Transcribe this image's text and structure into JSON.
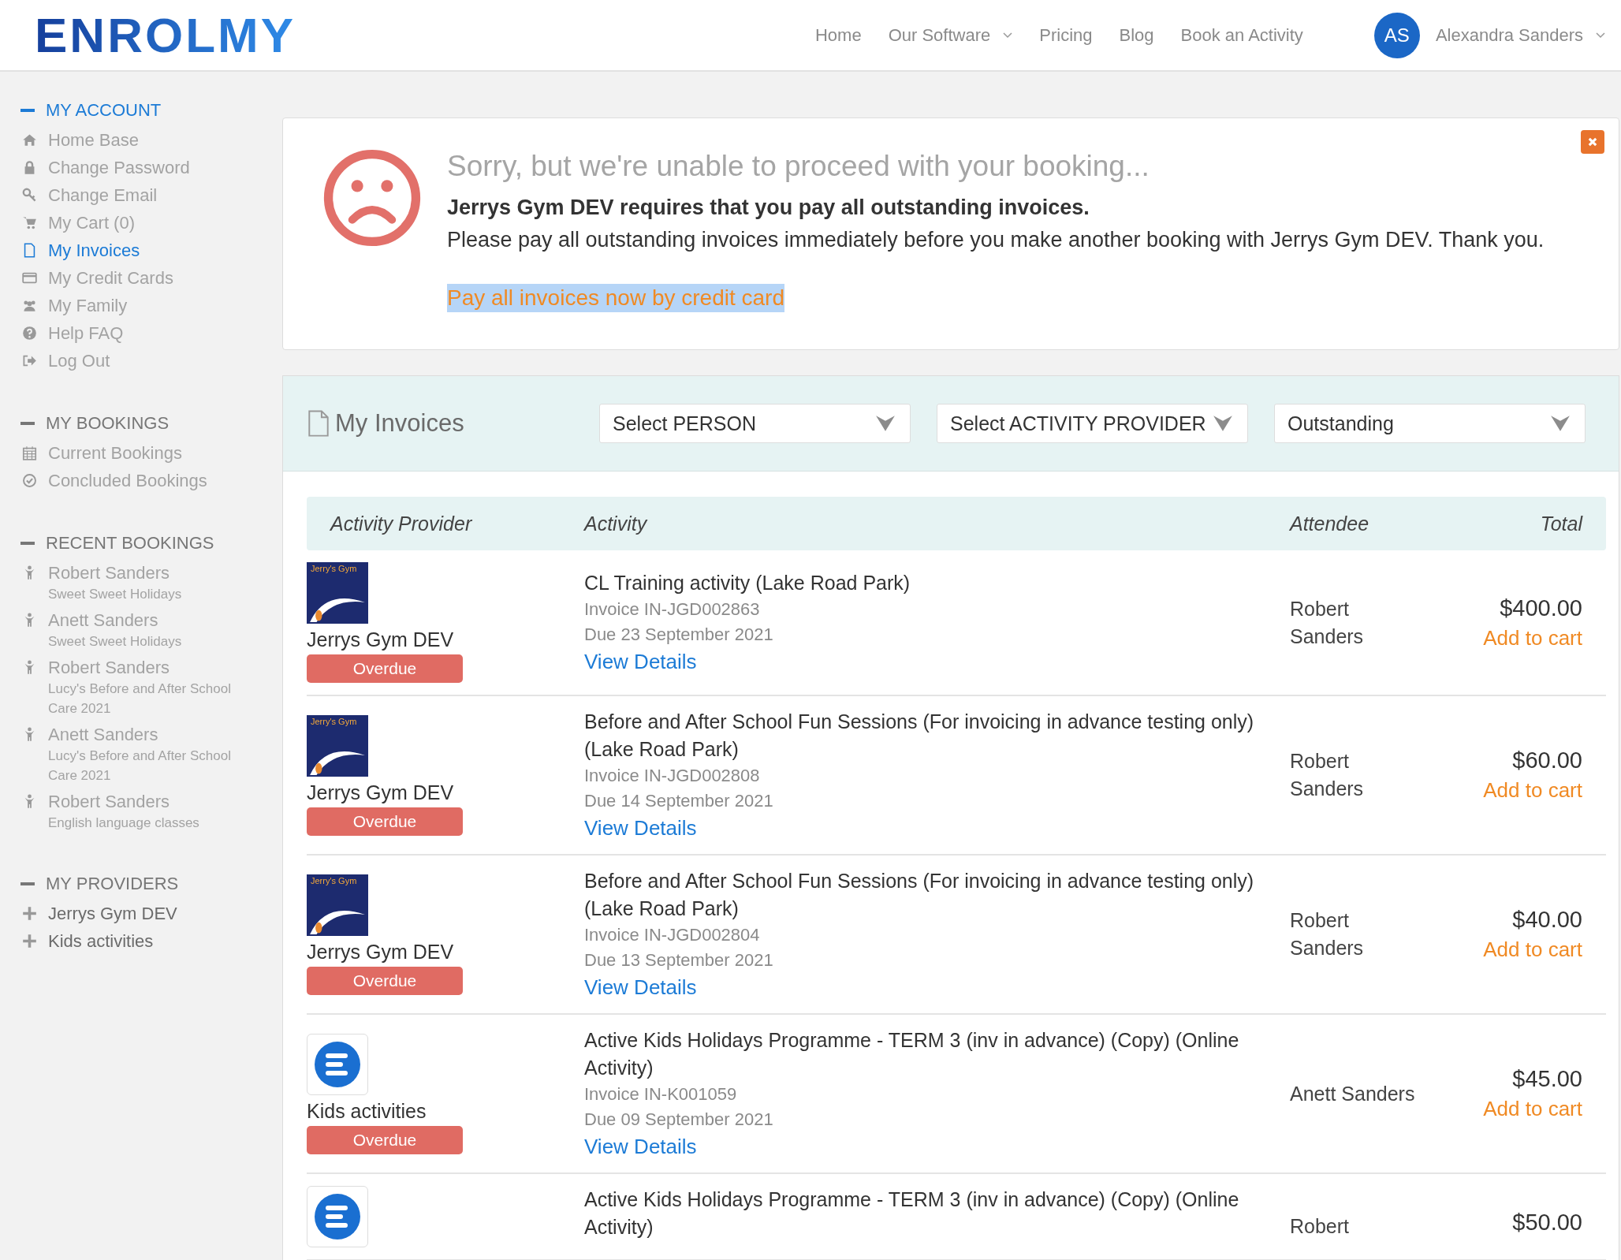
{
  "header": {
    "logo": "ENROLMY",
    "nav": [
      {
        "label": "Home",
        "dropdown": false
      },
      {
        "label": "Our Software",
        "dropdown": true
      },
      {
        "label": "Pricing",
        "dropdown": false
      },
      {
        "label": "Blog",
        "dropdown": false
      },
      {
        "label": "Book an Activity",
        "dropdown": false
      }
    ],
    "user": {
      "initials": "AS",
      "name": "Alexandra Sanders",
      "dropdown": true
    }
  },
  "sidebar": [
    {
      "title": "MY ACCOUNT",
      "active": true,
      "items": [
        {
          "label": "Home Base",
          "kind": "home",
          "selected": false
        },
        {
          "label": "Change Password",
          "kind": "lock",
          "selected": false
        },
        {
          "label": "Change Email",
          "kind": "key",
          "selected": false
        },
        {
          "label": "My Cart (0)",
          "kind": "cart",
          "selected": false
        },
        {
          "label": "My Invoices",
          "kind": "file",
          "selected": true
        },
        {
          "label": "My Credit Cards",
          "kind": "card",
          "selected": false
        },
        {
          "label": "My Family",
          "kind": "users",
          "selected": false
        },
        {
          "label": "Help FAQ",
          "kind": "help",
          "selected": false
        },
        {
          "label": "Log Out",
          "kind": "logout",
          "selected": false
        }
      ]
    },
    {
      "title": "MY BOOKINGS",
      "active": false,
      "items": [
        {
          "label": "Current Bookings",
          "kind": "calendar",
          "selected": false
        },
        {
          "label": "Concluded Bookings",
          "kind": "check",
          "selected": false
        }
      ]
    },
    {
      "title": "RECENT BOOKINGS",
      "active": false,
      "items": [
        {
          "label": "Robert Sanders",
          "sub": "Sweet Sweet Holidays",
          "kind": "person",
          "selected": false
        },
        {
          "label": "Anett Sanders",
          "sub": "Sweet Sweet Holidays",
          "kind": "person",
          "selected": false
        },
        {
          "label": "Robert Sanders",
          "sub": "Lucy's Before and After School Care 2021",
          "kind": "person",
          "selected": false
        },
        {
          "label": "Anett Sanders",
          "sub": "Lucy's Before and After School Care 2021",
          "kind": "person",
          "selected": false
        },
        {
          "label": "Robert Sanders",
          "sub": "English language classes",
          "kind": "person",
          "selected": false
        }
      ]
    },
    {
      "title": "MY PROVIDERS",
      "active": false,
      "items": [
        {
          "label": "Jerrys Gym DEV",
          "kind": "plus",
          "selected": false
        },
        {
          "label": "Kids activities",
          "kind": "plus",
          "selected": false
        }
      ]
    }
  ],
  "alert": {
    "title": "Sorry, but we're unable to proceed with your booking...",
    "bold": "Jerrys Gym DEV requires that you pay all outstanding invoices.",
    "message": "Please pay all outstanding invoices immediately before you make another booking with Jerrys Gym DEV. Thank you.",
    "link": "Pay all invoices now by credit card",
    "link_highlighted": true
  },
  "invoices": {
    "title": "My Invoices",
    "filters": [
      {
        "label": "Select PERSON"
      },
      {
        "label": "Select ACTIVITY PROVIDER"
      },
      {
        "label": "Outstanding"
      }
    ],
    "columns": [
      "Activity Provider",
      "Activity",
      "Attendee",
      "Total"
    ],
    "rows": [
      {
        "kind": "gym",
        "logo_text": "Jerry's Gym",
        "provider": "Jerrys Gym DEV",
        "status": "Overdue",
        "activity": "CL Training activity (Lake Road Park)",
        "invoice": "Invoice IN-JGD002863",
        "due": "Due 23 September 2021",
        "link": "View Details",
        "attendee": "Robert Sanders",
        "total": "$400.00",
        "action": "Add to cart"
      },
      {
        "kind": "gym",
        "logo_text": "Jerry's Gym",
        "provider": "Jerrys Gym DEV",
        "status": "Overdue",
        "activity": "Before and After School Fun Sessions (For invoicing in advance testing only) (Lake Road Park)",
        "invoice": "Invoice IN-JGD002808",
        "due": "Due 14 September 2021",
        "link": "View Details",
        "attendee": "Robert Sanders",
        "total": "$60.00",
        "action": "Add to cart"
      },
      {
        "kind": "gym",
        "logo_text": "Jerry's Gym",
        "provider": "Jerrys Gym DEV",
        "status": "Overdue",
        "activity": "Before and After School Fun Sessions (For invoicing in advance testing only) (Lake Road Park)",
        "invoice": "Invoice IN-JGD002804",
        "due": "Due 13 September 2021",
        "link": "View Details",
        "attendee": "Robert Sanders",
        "total": "$40.00",
        "action": "Add to cart"
      },
      {
        "kind": "enrolmy",
        "provider": "Kids activities",
        "status": "Overdue",
        "activity": "Active Kids Holidays Programme - TERM 3 (inv in advance) (Copy) (Online Activity)",
        "invoice": "Invoice IN-K001059",
        "due": "Due 09 September 2021",
        "link": "View Details",
        "attendee": "Anett Sanders",
        "total": "$45.00",
        "action": "Add to cart"
      },
      {
        "kind": "enrolmy",
        "activity": "Active Kids Holidays Programme - TERM 3 (inv in advance) (Copy) (Online Activity)",
        "attendee": "Robert",
        "total": "$50.00"
      }
    ]
  }
}
